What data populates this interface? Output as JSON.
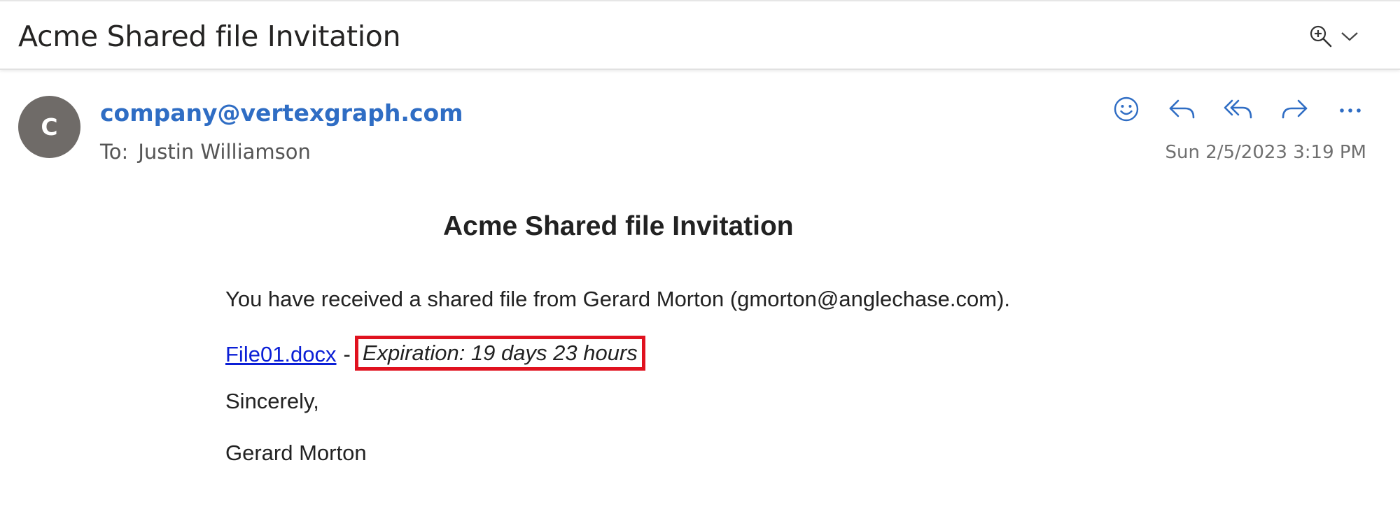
{
  "subject": {
    "title": "Acme Shared file Invitation",
    "zoom_icon": "zoom-in-icon",
    "dropdown_icon": "chevron-down-icon"
  },
  "message": {
    "avatar_initial": "C",
    "avatar_color": "#6f6b68",
    "sender": "company@vertexgraph.com",
    "to_label": "To:",
    "to_name": "Justin Williamson",
    "timestamp": "Sun 2/5/2023 3:19 PM",
    "accent_color": "#2f6dc4",
    "actions": [
      {
        "name": "emoji-react-icon"
      },
      {
        "name": "reply-icon"
      },
      {
        "name": "reply-all-icon"
      },
      {
        "name": "forward-icon"
      },
      {
        "name": "more-actions-icon"
      }
    ]
  },
  "body": {
    "heading": "Acme Shared file Invitation",
    "intro": "You have received a shared file from Gerard Morton (gmorton@anglechase.com).",
    "file_link": "File01.docx",
    "separator": "-",
    "expiration": "Expiration: 19 days 23 hours",
    "highlight_color": "#e0121f",
    "closing": "Sincerely,",
    "signature": "Gerard Morton"
  }
}
